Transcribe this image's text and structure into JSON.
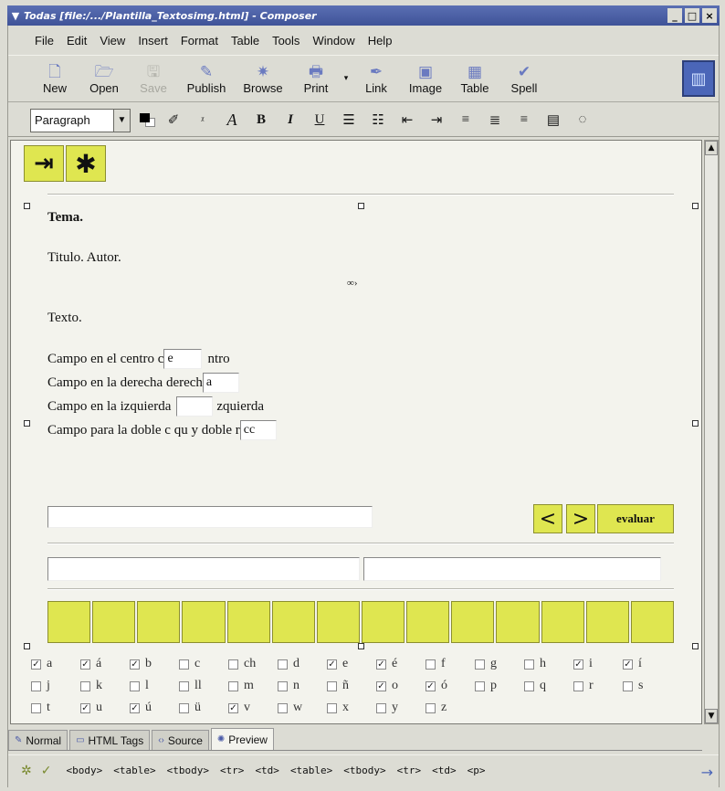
{
  "window": {
    "title": "Todas [file:/.../Plantilla_Textosimg.html] - Composer",
    "sys_icon": "menu-arrow-icon",
    "controls": [
      "_",
      "□",
      "×"
    ]
  },
  "menubar": {
    "items": [
      "File",
      "Edit",
      "View",
      "Insert",
      "Format",
      "Table",
      "Tools",
      "Window",
      "Help"
    ]
  },
  "toolbar": {
    "buttons": [
      {
        "label": "New",
        "icon": "new-doc-icon",
        "glyph": "🗋",
        "enabled": true
      },
      {
        "label": "Open",
        "icon": "open-icon",
        "glyph": "🗁",
        "enabled": true
      },
      {
        "label": "Save",
        "icon": "save-icon",
        "glyph": "🖫",
        "enabled": false
      },
      {
        "label": "Publish",
        "icon": "publish-icon",
        "glyph": "✎",
        "enabled": true
      },
      {
        "label": "Browse",
        "icon": "browse-icon",
        "glyph": "✷",
        "enabled": true
      },
      {
        "label": "Print",
        "icon": "print-icon",
        "glyph": "🖶",
        "enabled": true
      },
      {
        "label": "Link",
        "icon": "link-icon",
        "glyph": "✒",
        "enabled": true
      },
      {
        "label": "Image",
        "icon": "image-icon",
        "glyph": "▣",
        "enabled": true
      },
      {
        "label": "Table",
        "icon": "table-icon",
        "glyph": "▦",
        "enabled": true
      },
      {
        "label": "Spell",
        "icon": "spell-icon",
        "glyph": "✔",
        "enabled": true
      }
    ],
    "print_dropdown": "▾",
    "throbber_icon": "throbber-icon"
  },
  "formatbar": {
    "paragraph_value": "Paragraph",
    "buttons": [
      {
        "icon": "highlight-pen-icon",
        "glyph": "✐"
      },
      {
        "icon": "smaller-font-icon",
        "glyph": "ᵡ"
      },
      {
        "icon": "larger-font-icon",
        "glyph": "A"
      },
      {
        "icon": "bold-icon",
        "glyph": "B"
      },
      {
        "icon": "italic-icon",
        "glyph": "I"
      },
      {
        "icon": "underline-icon",
        "glyph": "U"
      },
      {
        "icon": "bullet-list-icon",
        "glyph": "☰"
      },
      {
        "icon": "numbered-list-icon",
        "glyph": "☷"
      },
      {
        "icon": "outdent-icon",
        "glyph": "⇤"
      },
      {
        "icon": "indent-icon",
        "glyph": "⇥"
      },
      {
        "icon": "align-left-icon",
        "glyph": "≡"
      },
      {
        "icon": "align-center-icon",
        "glyph": "≣"
      },
      {
        "icon": "align-right-icon",
        "glyph": "≡"
      },
      {
        "icon": "justify-icon",
        "glyph": "▤"
      },
      {
        "icon": "more-icon",
        "glyph": "◌"
      }
    ]
  },
  "document": {
    "top_buttons": [
      {
        "icon": "exit-icon",
        "glyph": "⇥"
      },
      {
        "icon": "asterisk-icon",
        "glyph": "✱"
      }
    ],
    "tema": "Tema.",
    "titulo_autor": "Titulo. Autor.",
    "anchor_mark": "∞›",
    "texto": "Texto.",
    "campos": [
      {
        "before": "Campo en el centro c",
        "value": "e",
        "after": "ntro"
      },
      {
        "before": "Campo en la derecha derech",
        "value": "a",
        "after": ""
      },
      {
        "before": "Campo en la izquierda",
        "value": "",
        "after": "zquierda"
      },
      {
        "before": "Campo para la doble c qu y doble r",
        "value": "cc",
        "after": ""
      }
    ],
    "nav_buttons": {
      "prev": "<",
      "next": ">",
      "evaluar": "evaluar"
    },
    "letters": [
      [
        {
          "l": "a",
          "c": true
        },
        {
          "l": "á",
          "c": true
        },
        {
          "l": "b",
          "c": true
        },
        {
          "l": "c",
          "c": false
        },
        {
          "l": "ch",
          "c": false
        },
        {
          "l": "d",
          "c": false
        },
        {
          "l": "e",
          "c": true
        },
        {
          "l": "é",
          "c": true
        },
        {
          "l": "f",
          "c": false
        },
        {
          "l": "g",
          "c": false
        },
        {
          "l": "h",
          "c": false
        },
        {
          "l": "i",
          "c": true
        },
        {
          "l": "í",
          "c": true
        }
      ],
      [
        {
          "l": "j",
          "c": false
        },
        {
          "l": "k",
          "c": false
        },
        {
          "l": "l",
          "c": false
        },
        {
          "l": "ll",
          "c": false
        },
        {
          "l": "m",
          "c": false
        },
        {
          "l": "n",
          "c": false
        },
        {
          "l": "ñ",
          "c": false
        },
        {
          "l": "o",
          "c": true
        },
        {
          "l": "ó",
          "c": true
        },
        {
          "l": "p",
          "c": false
        },
        {
          "l": "q",
          "c": false
        },
        {
          "l": "r",
          "c": false
        },
        {
          "l": "s",
          "c": false
        }
      ],
      [
        {
          "l": "t",
          "c": false
        },
        {
          "l": "u",
          "c": true
        },
        {
          "l": "ú",
          "c": true
        },
        {
          "l": "ü",
          "c": false
        },
        {
          "l": "v",
          "c": true
        },
        {
          "l": "w",
          "c": false
        },
        {
          "l": "x",
          "c": false
        },
        {
          "l": "y",
          "c": false
        },
        {
          "l": "z",
          "c": false
        }
      ]
    ]
  },
  "mode_tabs": [
    {
      "label": "Normal",
      "icon": "normal-mode-icon",
      "glyph": "✎"
    },
    {
      "label": "HTML Tags",
      "icon": "html-tags-icon",
      "glyph": "▭"
    },
    {
      "label": "Source",
      "icon": "source-icon",
      "glyph": "‹›"
    },
    {
      "label": "Preview",
      "icon": "preview-icon",
      "glyph": "✺",
      "active": true
    }
  ],
  "status": {
    "crumbs": [
      "<body>",
      "<table>",
      "<tbody>",
      "<tr>",
      "<td>",
      "<table>",
      "<tbody>",
      "<tr>",
      "<td>",
      "<p>"
    ]
  },
  "colors": {
    "titlebar": "#3f5398",
    "button_yellow": "#dfe650",
    "accent": "#4b66b8"
  }
}
